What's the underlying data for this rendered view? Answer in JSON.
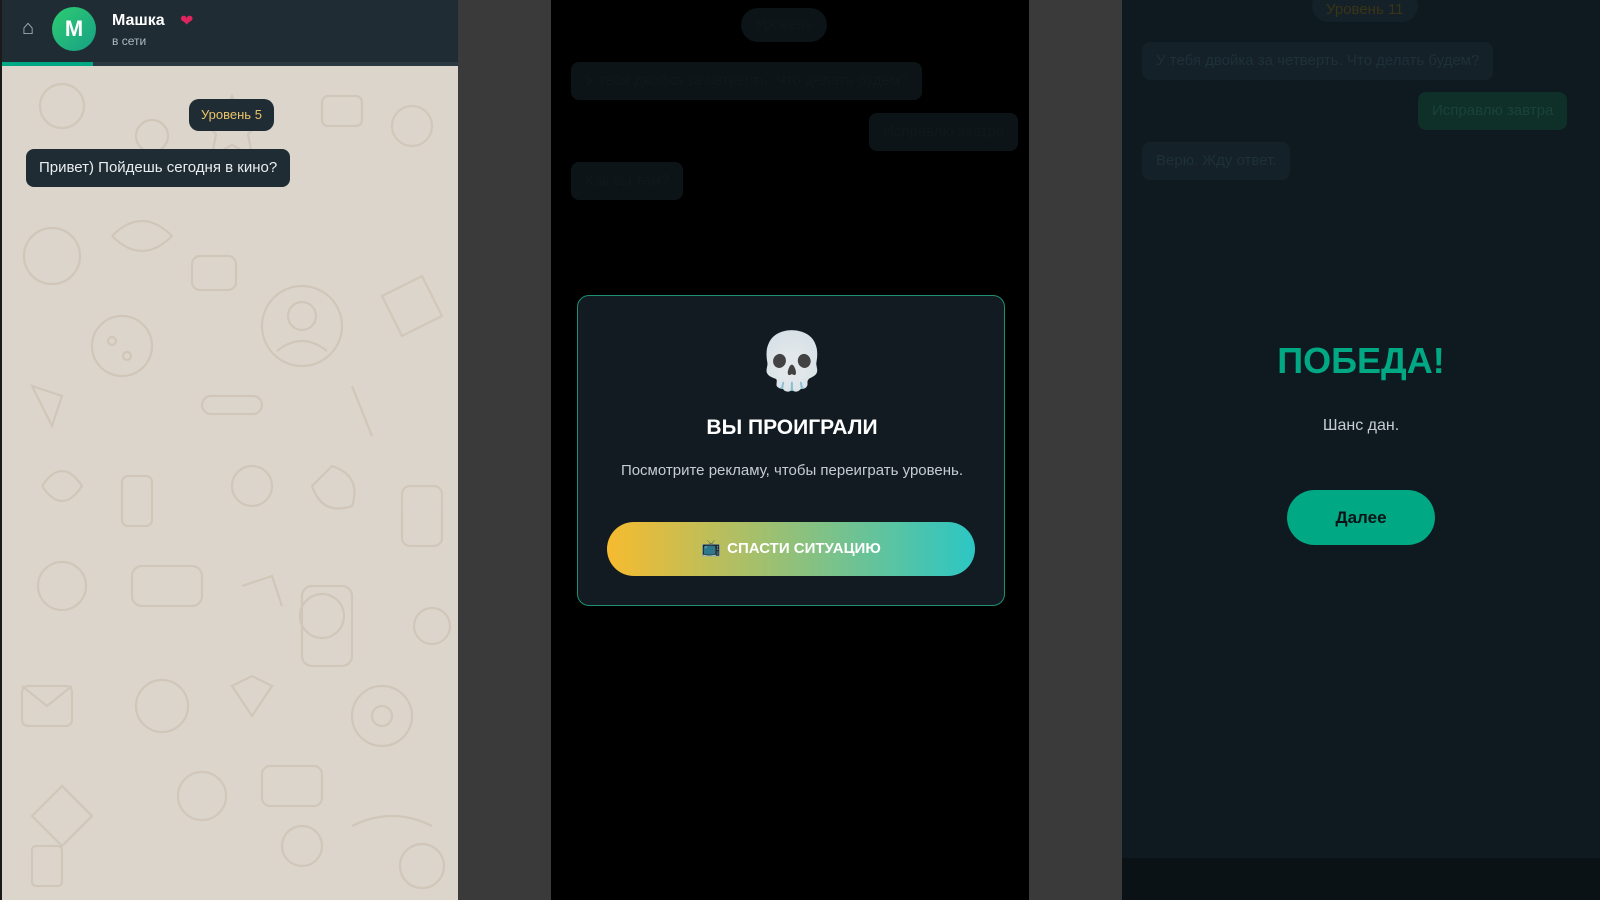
{
  "chat": {
    "contact_name": "Машка",
    "contact_emoji": "❤",
    "status": "в сети",
    "avatar_letter": "М",
    "level_label": "Уровень 5",
    "message": "Привет) Пойдешь сегодня в кино?",
    "progress_fraction": 0.2
  },
  "lose": {
    "ghost_level": "Уровень",
    "ghost_msg1": "У тебя двойка за четверть. Что делать будем?",
    "ghost_msg2": "Исправлю завтра",
    "ghost_msg3": "Как вы там?",
    "icon": "skull-icon",
    "title": "ВЫ ПРОИГРАЛИ",
    "text": "Посмотрите рекламу, чтобы переиграть уровень.",
    "button_label": "СПАСТИ СИТУАЦИЮ"
  },
  "win": {
    "ghost_level": "Уровень 11",
    "ghost_msg1": "У тебя двойка за четверть. Что делать будем?",
    "ghost_msg2": "Исправлю завтра",
    "ghost_msg3": "Верю. Жду ответ.",
    "title": "ПОБЕДА!",
    "text": "Шанс дан.",
    "button_label": "Далее"
  },
  "colors": {
    "accent": "#00a884",
    "header_bg": "#1f2c34",
    "level_text": "#e9c46a",
    "wallpaper": "#dcd5cc"
  }
}
